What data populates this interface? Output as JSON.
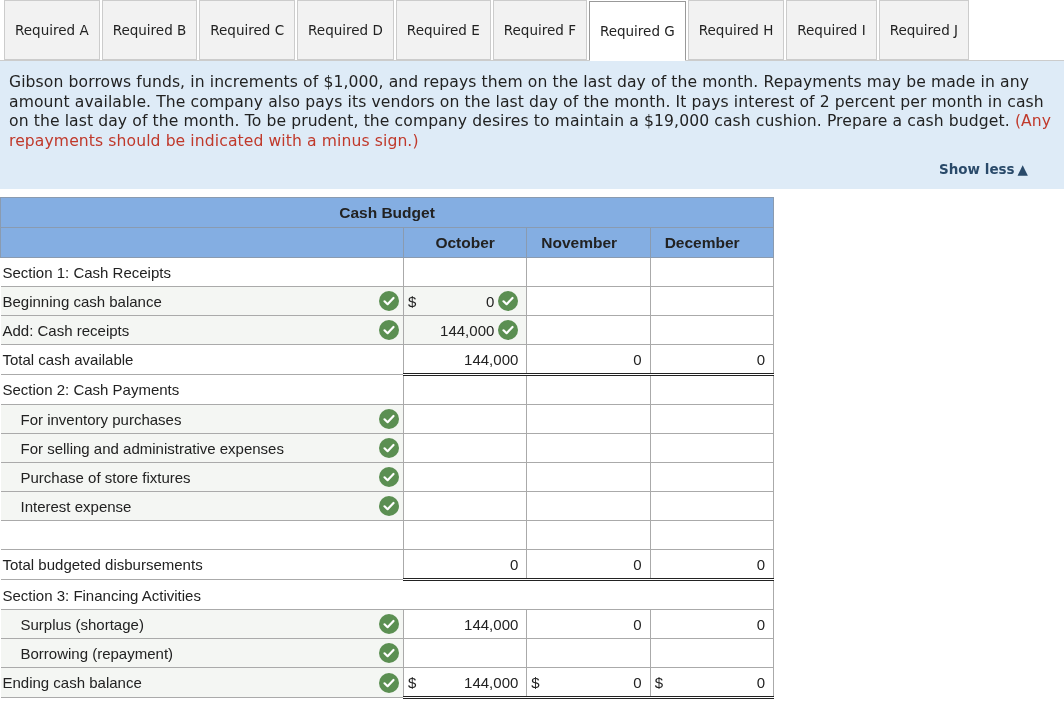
{
  "tabs": [
    {
      "label": "Required A",
      "selected": false
    },
    {
      "label": "Required B",
      "selected": false
    },
    {
      "label": "Required C",
      "selected": false
    },
    {
      "label": "Required D",
      "selected": false
    },
    {
      "label": "Required E",
      "selected": false
    },
    {
      "label": "Required F",
      "selected": false
    },
    {
      "label": "Required G",
      "selected": true
    },
    {
      "label": "Required H",
      "selected": false
    },
    {
      "label": "Required I",
      "selected": false
    },
    {
      "label": "Required J",
      "selected": false
    }
  ],
  "instructions": {
    "text": "Gibson borrows funds, in increments of $1,000, and repays them on the last day of the month. Repayments may be made in any amount available. The company also pays its vendors on the last day of the month. It pays interest of 2 percent per month in cash on the last day of the month. To be prudent, the company desires to maintain a $19,000 cash cushion. Prepare a cash budget.",
    "note": "(Any repayments should be indicated with a minus sign.)",
    "toggle": "Show less",
    "toggle_icon": "▲"
  },
  "table": {
    "title": "Cash Budget",
    "columns": [
      "October",
      "November",
      "December"
    ],
    "rows": [
      {
        "kind": "section",
        "label": "Section 1: Cash Receipts",
        "spanned": false
      },
      {
        "kind": "item",
        "label": "Beginning cash balance",
        "checked": true,
        "cells": [
          {
            "dollar": "$",
            "value": "0",
            "checked": true
          },
          null,
          null
        ]
      },
      {
        "kind": "item",
        "label": "Add: Cash receipts",
        "checked": true,
        "cells": [
          {
            "value": "144,000",
            "checked": true
          },
          null,
          null
        ]
      },
      {
        "kind": "total",
        "label": "Total cash available",
        "checked": false,
        "cells": [
          {
            "value": "144,000"
          },
          {
            "value": "0"
          },
          {
            "value": "0"
          }
        ]
      },
      {
        "kind": "section",
        "label": "Section 2: Cash Payments",
        "spanned": false,
        "children": [
          {
            "kind": "item",
            "label": "For inventory purchases",
            "checked": true
          },
          {
            "kind": "item",
            "label": "For selling and administrative expenses",
            "checked": true
          },
          {
            "kind": "item",
            "label": "Purchase of store fixtures",
            "checked": true
          },
          {
            "kind": "item",
            "label": "Interest expense",
            "checked": true
          }
        ]
      },
      {
        "kind": "blank"
      },
      {
        "kind": "total",
        "label": "Total budgeted disbursements",
        "checked": false,
        "cells": [
          {
            "value": "0"
          },
          {
            "value": "0"
          },
          {
            "value": "0"
          }
        ]
      },
      {
        "kind": "section",
        "label": "Section 3: Financing Activities",
        "spanned": true,
        "children": [
          {
            "kind": "item",
            "label": "Surplus (shortage)",
            "checked": true,
            "cells": [
              {
                "value": "144,000"
              },
              {
                "value": "0"
              },
              {
                "value": "0"
              }
            ]
          },
          {
            "kind": "item",
            "label": "Borrowing (repayment)",
            "checked": true
          }
        ]
      },
      {
        "kind": "final",
        "label": "Ending cash balance",
        "checked": true,
        "cells": [
          {
            "dollar": "$",
            "value": "144,000"
          },
          {
            "dollar": "$",
            "value": "0"
          },
          {
            "dollar": "$",
            "value": "0"
          }
        ]
      }
    ]
  }
}
